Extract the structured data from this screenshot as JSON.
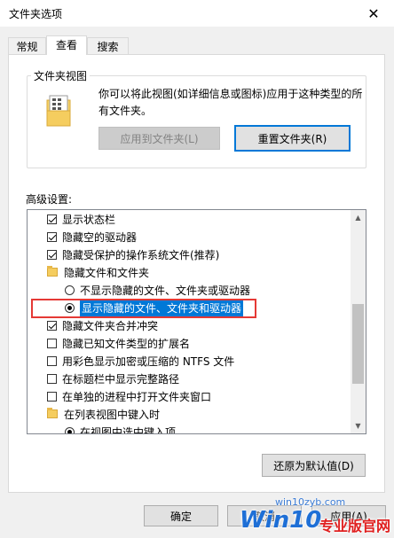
{
  "window": {
    "title": "文件夹选项",
    "close_glyph": "✕"
  },
  "tabs": [
    {
      "label": "常规"
    },
    {
      "label": "查看"
    },
    {
      "label": "搜索"
    }
  ],
  "folder_views": {
    "legend": "文件夹视图",
    "description_line1": "你可以将此视图(如详细信息或图标)应用于这种类型的所",
    "description_line2": "有文件夹。",
    "apply_button": "应用到文件夹(L)",
    "reset_button": "重置文件夹(R)"
  },
  "advanced": {
    "label": "高级设置:",
    "items": [
      {
        "type": "checkbox",
        "checked": true,
        "label": "显示状态栏"
      },
      {
        "type": "checkbox",
        "checked": true,
        "label": "隐藏空的驱动器"
      },
      {
        "type": "checkbox",
        "checked": true,
        "label": "隐藏受保护的操作系统文件(推荐)"
      },
      {
        "type": "folder",
        "label": "隐藏文件和文件夹"
      },
      {
        "type": "radio",
        "selected": false,
        "label": "不显示隐藏的文件、文件夹或驱动器"
      },
      {
        "type": "radio",
        "selected": true,
        "label": "显示隐藏的文件、文件夹和驱动器"
      },
      {
        "type": "checkbox",
        "checked": true,
        "label": "隐藏文件夹合并冲突"
      },
      {
        "type": "checkbox",
        "checked": false,
        "label": "隐藏已知文件类型的扩展名"
      },
      {
        "type": "checkbox",
        "checked": false,
        "label": "用彩色显示加密或压缩的 NTFS 文件"
      },
      {
        "type": "checkbox",
        "checked": false,
        "label": "在标题栏中显示完整路径"
      },
      {
        "type": "checkbox",
        "checked": false,
        "label": "在单独的进程中打开文件夹窗口"
      },
      {
        "type": "folder",
        "label": "在列表视图中键入时"
      },
      {
        "type": "radio",
        "selected": true,
        "label": "在视图中选中键入项"
      }
    ],
    "restore_button": "还原为默认值(D)"
  },
  "footer": {
    "ok_button": "确定",
    "cancel_button": "取消",
    "apply_button": "应用(A)"
  },
  "watermark": {
    "brand": "Win10",
    "tagline": "专业版官网",
    "url": "win10zyb.com"
  },
  "colors": {
    "selection": "#0078d7",
    "highlight_box": "#e53935",
    "folder": "#f5cd5f"
  }
}
